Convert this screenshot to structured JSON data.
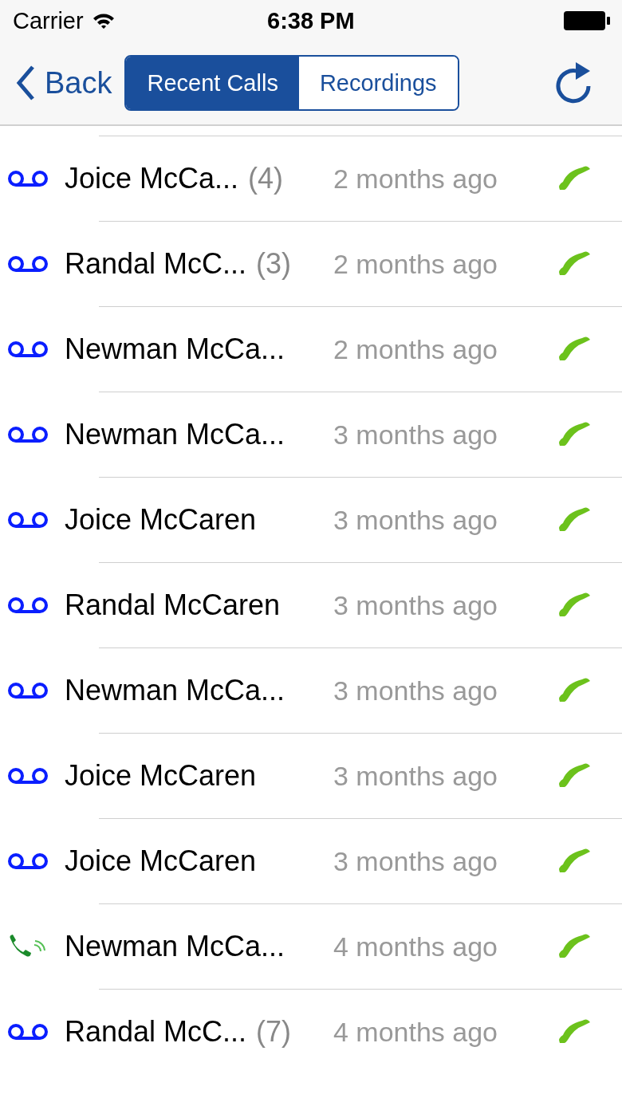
{
  "status_bar": {
    "carrier": "Carrier",
    "time": "6:38 PM"
  },
  "nav": {
    "back": "Back",
    "segments": [
      {
        "label": "Recent Calls",
        "selected": true
      },
      {
        "label": "Recordings",
        "selected": false
      }
    ]
  },
  "rows": [
    {
      "kind": "voicemail",
      "name": "Joice McCa...",
      "count": "(4)",
      "time": "2 months ago"
    },
    {
      "kind": "voicemail",
      "name": "Randal McC...",
      "count": "(3)",
      "time": "2 months ago"
    },
    {
      "kind": "voicemail",
      "name": "Newman McCa...",
      "time": "2 months ago"
    },
    {
      "kind": "voicemail",
      "name": "Newman McCa...",
      "time": "3 months ago"
    },
    {
      "kind": "voicemail",
      "name": "Joice McCaren",
      "time": "3 months ago"
    },
    {
      "kind": "voicemail",
      "name": "Randal McCaren",
      "time": "3 months ago"
    },
    {
      "kind": "voicemail",
      "name": "Newman McCa...",
      "time": "3 months ago"
    },
    {
      "kind": "voicemail",
      "name": "Joice McCaren",
      "time": "3 months ago"
    },
    {
      "kind": "voicemail",
      "name": "Joice McCaren",
      "time": "3 months ago"
    },
    {
      "kind": "call",
      "name": "Newman McCa...",
      "time": "4 months ago"
    },
    {
      "kind": "voicemail",
      "name": "Randal McC...",
      "count": "(7)",
      "time": "4 months ago"
    }
  ]
}
